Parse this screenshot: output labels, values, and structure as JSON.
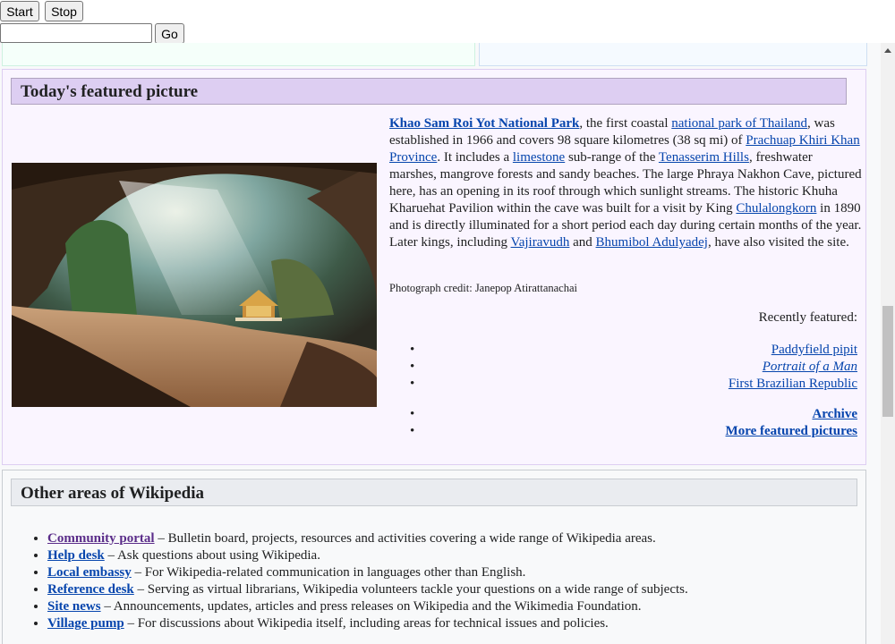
{
  "controls": {
    "start_label": "Start",
    "stop_label": "Stop",
    "url_value": "",
    "go_label": "Go"
  },
  "featured": {
    "heading": "Today's featured picture",
    "photo_alt": "Phraya Nakhon Cave with pavilion",
    "blurb": {
      "title_link": "Khao Sam Roi Yot National Park",
      "t1": ", the first coastal ",
      "link_np": "national park of Thailand",
      "t2": ", was established in 1966 and covers 98 square kilometres (38 sq mi) of ",
      "link_prov": "Prachuap Khiri Khan Province",
      "t3": ". It includes a ",
      "link_lime": "limestone",
      "t4": " sub-range of the ",
      "link_hills": "Tenasserim Hills",
      "t5": ", freshwater marshes, mangrove forests and sandy beaches. The large Phraya Nakhon Cave, pictured here, has an opening in its roof through which sunlight streams. The historic Khuha Kharuehat Pavilion within the cave was built for a visit by King ",
      "link_chul": "Chulalongkorn",
      "t6": " in 1890 and is directly illuminated for a short period each day during certain months of the year. Later kings, including ",
      "link_vaj": "Vajiravudh",
      "t7": " and ",
      "link_bhu": "Bhumibol Adulyadej",
      "t8": ", have also visited the site."
    },
    "credit": "Photograph credit: Janepop Atirattanachai",
    "recently_label": "Recently featured:",
    "recent": [
      "Paddyfield pipit",
      "Portrait of a Man",
      "First Brazilian Republic"
    ],
    "archive": "Archive",
    "more": "More featured pictures"
  },
  "other": {
    "heading": "Other areas of Wikipedia",
    "items": [
      {
        "link": "Community portal",
        "desc": " – Bulletin board, projects, resources and activities covering a wide range of Wikipedia areas."
      },
      {
        "link": "Help desk",
        "desc": " – Ask questions about using Wikipedia."
      },
      {
        "link": "Local embassy",
        "desc": " – For Wikipedia-related communication in languages other than English."
      },
      {
        "link": "Reference desk",
        "desc": " – Serving as virtual librarians, Wikipedia volunteers tackle your questions on a wide range of subjects."
      },
      {
        "link": "Site news",
        "desc": " – Announcements, updates, articles and press releases on Wikipedia and the Wikimedia Foundation."
      },
      {
        "link": "Village pump",
        "desc": " – For discussions about Wikipedia itself, including areas for technical issues and policies."
      }
    ]
  }
}
